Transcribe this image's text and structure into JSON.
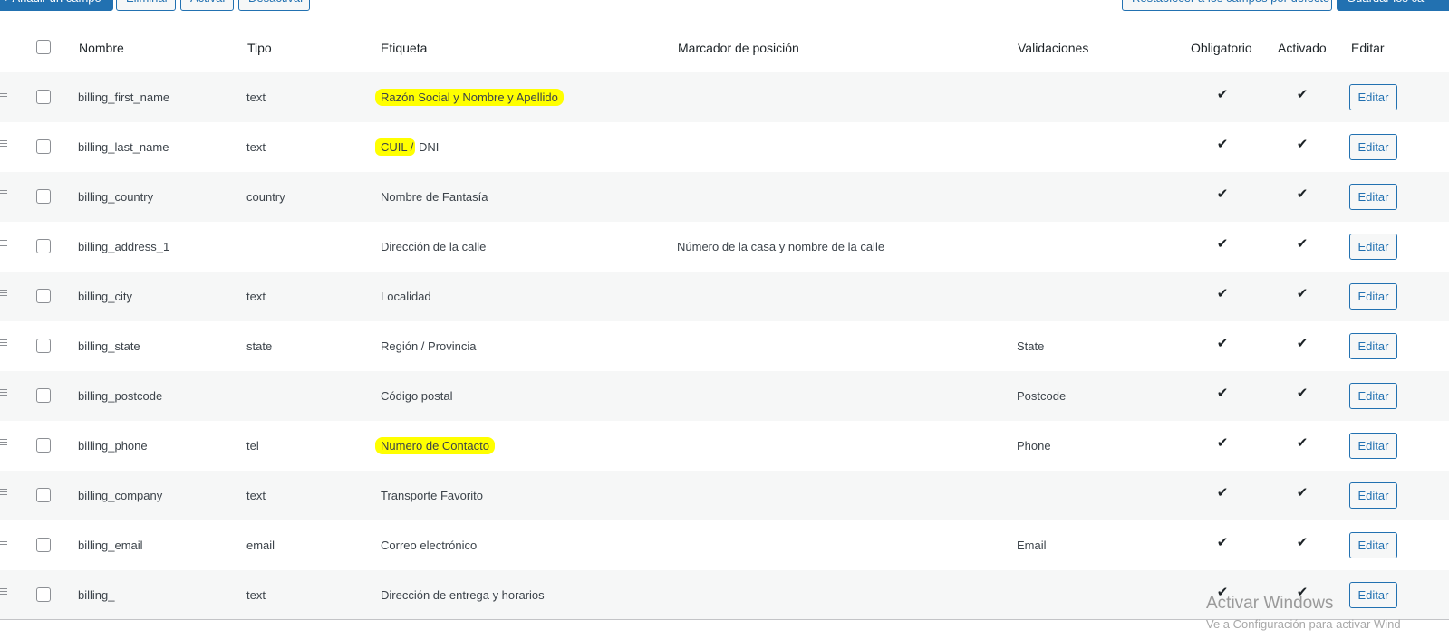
{
  "toolbar": {
    "add_label": "+ Añadir un campo",
    "delete_label": "Eliminar",
    "enable_label": "Activar",
    "disable_label": "Desactivar",
    "reset_label": "Restablecer a los campos por defecto",
    "save_label": "Guardar los ca"
  },
  "table": {
    "headers": {
      "name": "Nombre",
      "type": "Tipo",
      "label": "Etiqueta",
      "placeholder": "Marcador de posición",
      "validations": "Validaciones",
      "required": "Obligatorio",
      "enabled": "Activado",
      "edit": "Editar"
    },
    "rows": [
      {
        "name": "billing_first_name",
        "type": "text",
        "label": "Razón Social y Nombre y Apellido",
        "placeholder": "",
        "validations": "",
        "required": "✔",
        "enabled": "✔",
        "edit": "Editar"
      },
      {
        "name": "billing_last_name",
        "type": "text",
        "label_highlight": "CUIL /",
        "label_rest": " DNI",
        "placeholder": "",
        "validations": "",
        "required": "✔",
        "enabled": "✔",
        "edit": "Editar"
      },
      {
        "name": "billing_country",
        "type": "country",
        "label": "Nombre de Fantasía",
        "placeholder": "",
        "validations": "",
        "required": "✔",
        "enabled": "✔",
        "edit": "Editar"
      },
      {
        "name": "billing_address_1",
        "type": "",
        "label": "Dirección de la calle",
        "placeholder": "Número de la casa y nombre de la calle",
        "validations": "",
        "required": "✔",
        "enabled": "✔",
        "edit": "Editar"
      },
      {
        "name": "billing_city",
        "type": "text",
        "label": "Localidad",
        "placeholder": "",
        "validations": "",
        "required": "✔",
        "enabled": "✔",
        "edit": "Editar"
      },
      {
        "name": "billing_state",
        "type": "state",
        "label": "Región / Provincia",
        "placeholder": "",
        "validations": "State",
        "required": "✔",
        "enabled": "✔",
        "edit": "Editar"
      },
      {
        "name": "billing_postcode",
        "type": "",
        "label": "Código postal",
        "placeholder": "",
        "validations": "Postcode",
        "required": "✔",
        "enabled": "✔",
        "edit": "Editar"
      },
      {
        "name": "billing_phone",
        "type": "tel",
        "label": "Numero de Contacto",
        "placeholder": "",
        "validations": "Phone",
        "required": "✔",
        "enabled": "✔",
        "edit": "Editar"
      },
      {
        "name": "billing_company",
        "type": "text",
        "label": "Transporte Favorito",
        "placeholder": "",
        "validations": "",
        "required": "✔",
        "enabled": "✔",
        "edit": "Editar"
      },
      {
        "name": "billing_email",
        "type": "email",
        "label": "Correo electrónico",
        "placeholder": "",
        "validations": "Email",
        "required": "✔",
        "enabled": "✔",
        "edit": "Editar"
      },
      {
        "name": "billing_",
        "type": "text",
        "label": "Dirección de entrega y horarios",
        "placeholder": "",
        "validations": "",
        "required": "✔",
        "enabled": "✔",
        "edit": "Editar"
      }
    ]
  },
  "watermark": {
    "line1": "Activar Windows",
    "line2": "Ve a Configuración para activar Wind"
  },
  "colors": {
    "accent": "#2271b1",
    "highlight": "#ffff00"
  },
  "icons": {
    "drag_handle": "drag-handle-icon",
    "check": "checkmark-icon"
  }
}
